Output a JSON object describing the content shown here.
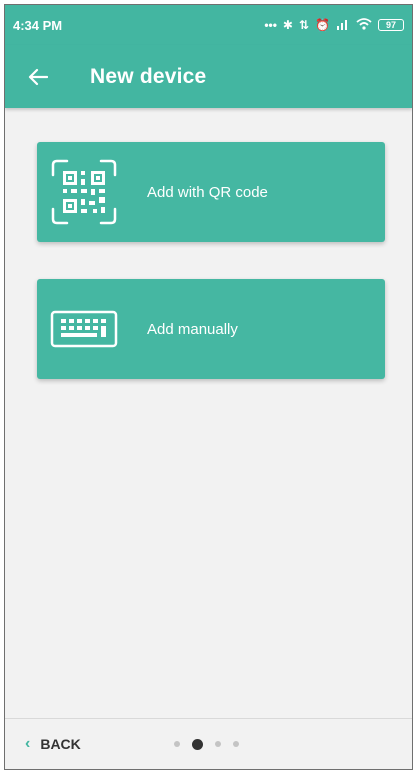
{
  "status_bar": {
    "time": "4:34 PM",
    "indicators": [
      "dots-icon",
      "bluetooth-icon",
      "data-icon",
      "alarm-icon",
      "signal-icon",
      "wifi-icon"
    ],
    "battery": "97"
  },
  "app_bar": {
    "back_icon": "arrow-left-icon",
    "title": "New device"
  },
  "options": [
    {
      "icon": "qr-code-icon",
      "label": "Add with QR code"
    },
    {
      "icon": "keyboard-icon",
      "label": "Add manually"
    }
  ],
  "footer": {
    "back_label": "BACK",
    "back_icon": "chevron-left-icon",
    "pages": 4,
    "active_page": 2
  },
  "colors": {
    "primary": "#43b6a1",
    "background": "#f2f2f2",
    "text_dark": "#333333"
  }
}
